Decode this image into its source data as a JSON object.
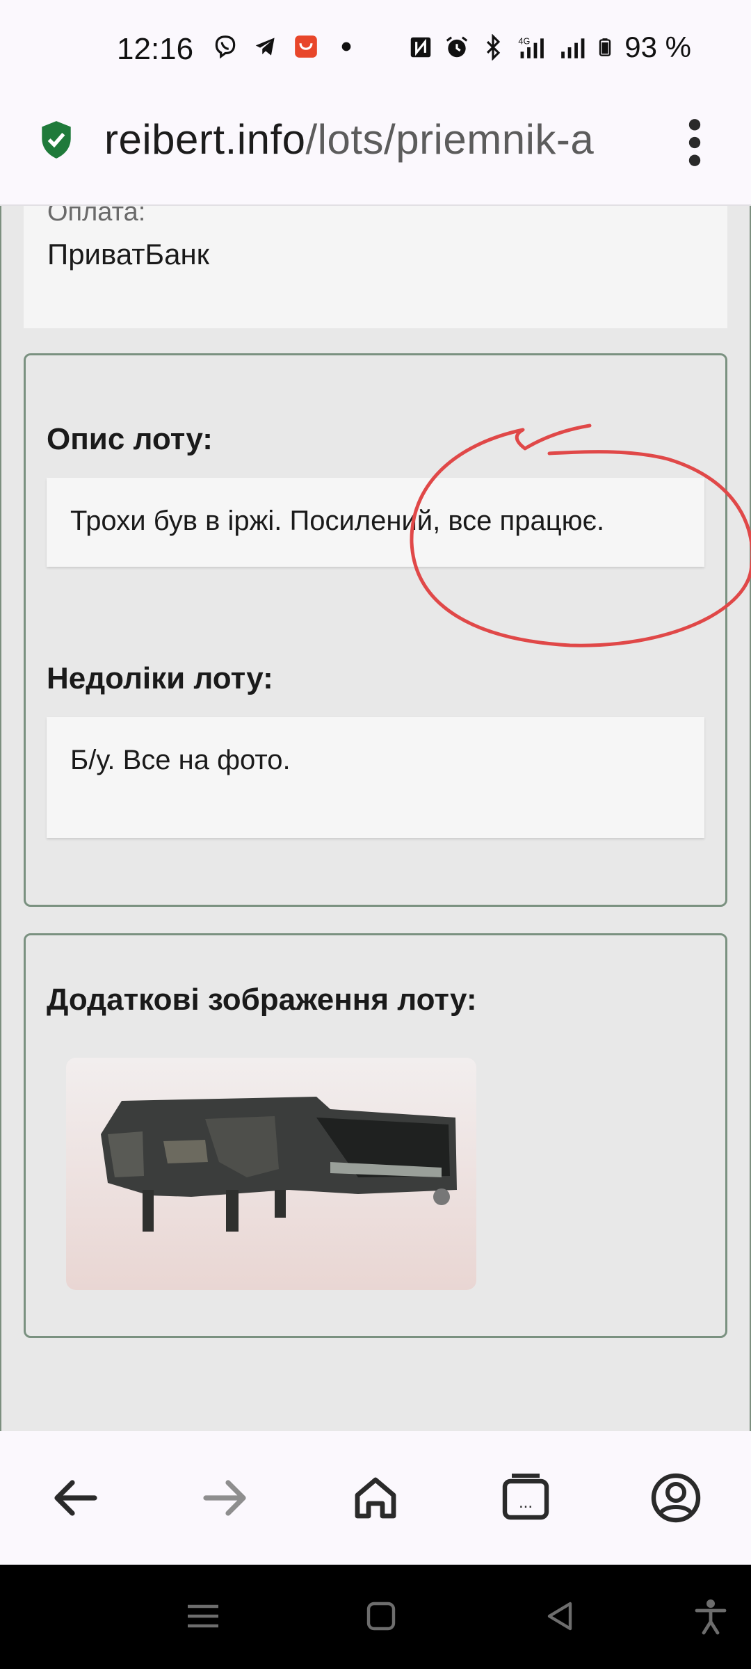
{
  "status_bar": {
    "time": "12:16",
    "battery_text": "93 %",
    "left_icons": [
      "viber-icon",
      "telegram-icon",
      "aliexpress-icon",
      "dot-icon"
    ],
    "right_icons": [
      "nfc-icon",
      "alarm-icon",
      "bluetooth-icon",
      "signal-4g-icon",
      "signal-icon",
      "battery-icon"
    ]
  },
  "browser": {
    "url_domain": "reibert.info",
    "url_path": "/lots/priemnik-a"
  },
  "payment": {
    "label": "Оплата:",
    "value": "ПриватБанк"
  },
  "description": {
    "title": "Опис лоту:",
    "text": "Трохи був в іржі. Посилений, все працює."
  },
  "defects": {
    "title": "Недоліки лоту:",
    "text": "Б/у. Все на фото."
  },
  "images": {
    "title": "Додаткові зображення лоту:"
  },
  "colors": {
    "accent_border": "#7a9180",
    "annotation": "#e04848",
    "shield": "#1f7a3a"
  },
  "toolbar_icons": [
    "back-arrow-icon",
    "forward-arrow-icon",
    "home-icon",
    "tabs-icon",
    "account-icon"
  ],
  "system_nav_icons": [
    "recents-icon",
    "home-square-icon",
    "back-triangle-icon",
    "accessibility-icon"
  ]
}
